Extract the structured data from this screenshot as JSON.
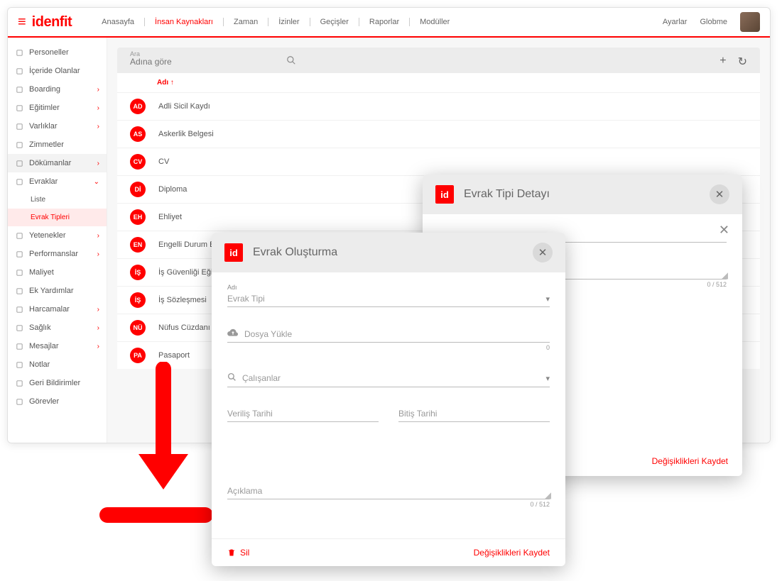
{
  "brand": "idenfit",
  "topnav": [
    "Anasayfa",
    "İnsan Kaynakları",
    "Zaman",
    "İzinler",
    "Geçişler",
    "Raporlar",
    "Modüller"
  ],
  "topnav_active": 1,
  "settings": "Ayarlar",
  "username": "Globme",
  "sidebar": [
    {
      "icon": "person",
      "label": "Personeller"
    },
    {
      "icon": "inside",
      "label": "İçeride Olanlar"
    },
    {
      "icon": "box",
      "label": "Boarding",
      "chev": ">"
    },
    {
      "icon": "edu",
      "label": "Eğitimler",
      "chev": ">"
    },
    {
      "icon": "asset",
      "label": "Varlıklar",
      "chev": ">"
    },
    {
      "icon": "assign",
      "label": "Zimmetler"
    },
    {
      "icon": "doc",
      "label": "Dökümanlar",
      "chev": ">",
      "grey": true
    },
    {
      "icon": "file",
      "label": "Evraklar",
      "chev": "v"
    },
    {
      "icon": "",
      "label": "Liste",
      "sub": true
    },
    {
      "icon": "",
      "label": "Evrak Tipleri",
      "sub": true,
      "pink": true
    },
    {
      "icon": "skill",
      "label": "Yetenekler",
      "chev": ">"
    },
    {
      "icon": "perf",
      "label": "Performanslar",
      "chev": ">"
    },
    {
      "icon": "cost",
      "label": "Maliyet"
    },
    {
      "icon": "aid",
      "label": "Ek Yardımlar"
    },
    {
      "icon": "spend",
      "label": "Harcamalar",
      "chev": ">"
    },
    {
      "icon": "health",
      "label": "Sağlık",
      "chev": ">"
    },
    {
      "icon": "msg",
      "label": "Mesajlar",
      "chev": ">"
    },
    {
      "icon": "note",
      "label": "Notlar"
    },
    {
      "icon": "feedback",
      "label": "Geri Bildirimler"
    },
    {
      "icon": "task",
      "label": "Görevler"
    }
  ],
  "search": {
    "label": "Ara",
    "placeholder": "Adına göre"
  },
  "table": {
    "header": "Adı",
    "sort": "↑"
  },
  "rows": [
    {
      "badge": "AD",
      "name": "Adli Sicil Kaydı"
    },
    {
      "badge": "AS",
      "name": "Askerlik Belgesi"
    },
    {
      "badge": "CV",
      "name": "CV"
    },
    {
      "badge": "Dİ",
      "name": "Diploma"
    },
    {
      "badge": "EH",
      "name": "Ehliyet"
    },
    {
      "badge": "EN",
      "name": "Engelli Durum Belgesi"
    },
    {
      "badge": "İŞ",
      "name": "İş Güvenliği Eğitim Belgesi"
    },
    {
      "badge": "İŞ",
      "name": "İş Sözleşmesi"
    },
    {
      "badge": "NÜ",
      "name": "Nüfus Cüzdanı"
    },
    {
      "badge": "PA",
      "name": "Pasaport"
    }
  ],
  "modal_detay": {
    "title": "Evrak Tipi Detayı",
    "counter": "0 / 512",
    "save": "Değişiklikleri Kaydet"
  },
  "modal_create": {
    "title": "Evrak Oluşturma",
    "adi_label": "Adı",
    "adi_placeholder": "Evrak Tipi",
    "upload": "Dosya Yükle",
    "upload_counter": "0",
    "employees": "Çalışanlar",
    "start_date": "Veriliş Tarihi",
    "end_date": "Bitiş Tarihi",
    "desc": "Açıklama",
    "desc_counter": "0 / 512",
    "delete": "Sil",
    "save": "Değişiklikleri Kaydet"
  }
}
